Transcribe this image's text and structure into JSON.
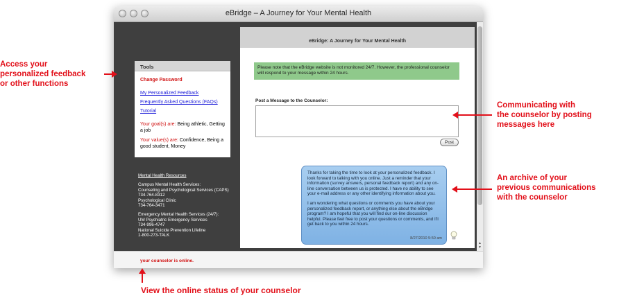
{
  "window": {
    "title": "eBridge – A Journey for Your Mental Health"
  },
  "tools": {
    "header": "Tools",
    "change_password": "Change Password",
    "links": [
      "My Personalized Feedback",
      "Frequently Asked Questions (FAQs)",
      "Tutorial"
    ],
    "goals_label": "Your goal(s) are:",
    "goals_value": "Being athletic, Getting a job",
    "values_label": "Your value(s) are:",
    "values_value": "Confidence, Being a good student, Money"
  },
  "resources": {
    "heading": "Mental Health Resources",
    "group1": [
      "Campus Mental Health Services:",
      "Counseling and Psychological Services (CAPS)",
      "734-764-8312",
      "Psychological Clinic",
      "734-764-3471"
    ],
    "group2": [
      "Emergency Mental Health Services (24/7):",
      "UM Psychiatric Emergency Services",
      "734-996-4747",
      "National Suicide Prevention Lifeline",
      "1-800-273-TALK"
    ]
  },
  "content": {
    "header": "eBridge: A Journey for Your Mental Health",
    "notice": "Please note that the eBridge website is not monitored 24/7. However, the professional counselor will respond to your message within 24 hours.",
    "post_label": "Post a Message to the Counselor:",
    "post_button": "Post",
    "message_p1": "Thanks for taking the time to look at your personalized feedback. I look forward to talking with you online. Just a reminder that your information (survey answers, personal feedback report) and any on-line conversation between us is protected. I have no ability to see your e-mail address or any other identifying information about you.",
    "message_p2": "I am wondering what questions or comments you have about your personalized feedback report, or anything else about the eBridge program? I am hopeful that you will find our on-line discussion helpful. Please feel free to post your questions or comments, and I'll get back to you within 24 hours.",
    "message_timestamp": "8/27/2010 5:50 am"
  },
  "status": {
    "text": "your counselor is online."
  },
  "annotations": {
    "left": [
      "Access your",
      "personalized feedback",
      "or other functions"
    ],
    "right_top": [
      "Communicating with",
      "the counselor by posting",
      "messages here"
    ],
    "right_bottom": [
      "An archive of your",
      "previous communications",
      "with the counselor"
    ],
    "bottom": "View the online status of your counselor"
  },
  "colors": {
    "annotation": "#e2101a",
    "notice_bg": "#8fc98b",
    "bubble_bg": "#8fbfea",
    "sidebar_bg": "#3f3f3f"
  }
}
